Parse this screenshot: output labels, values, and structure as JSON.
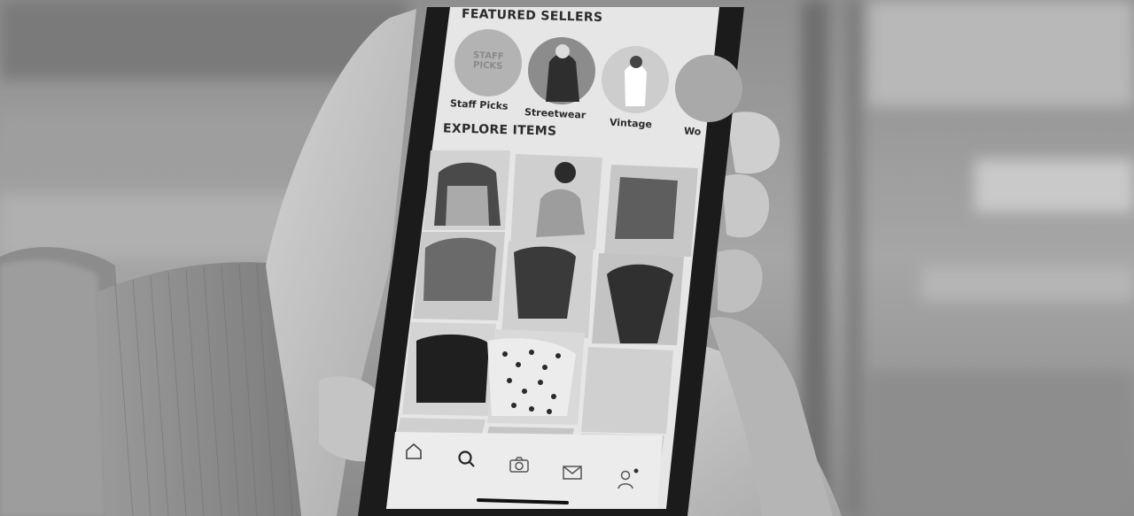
{
  "featured": {
    "heading": "FEATURED SELLERS",
    "sellers": [
      {
        "label": "Staff Picks",
        "badge": "STAFF PICKS"
      },
      {
        "label": "Streetwear"
      },
      {
        "label": "Vintage"
      },
      {
        "label": "Wo"
      }
    ]
  },
  "explore": {
    "heading": "EXPLORE ITEMS"
  },
  "nav": {
    "items": [
      {
        "icon": "home-icon"
      },
      {
        "icon": "search-icon"
      },
      {
        "icon": "camera-icon"
      },
      {
        "icon": "mail-icon"
      },
      {
        "icon": "profile-icon"
      }
    ]
  },
  "colors": {
    "screen": "#e6e6e6",
    "frame": "#1b1b1b",
    "background": "#9a9a9a"
  }
}
